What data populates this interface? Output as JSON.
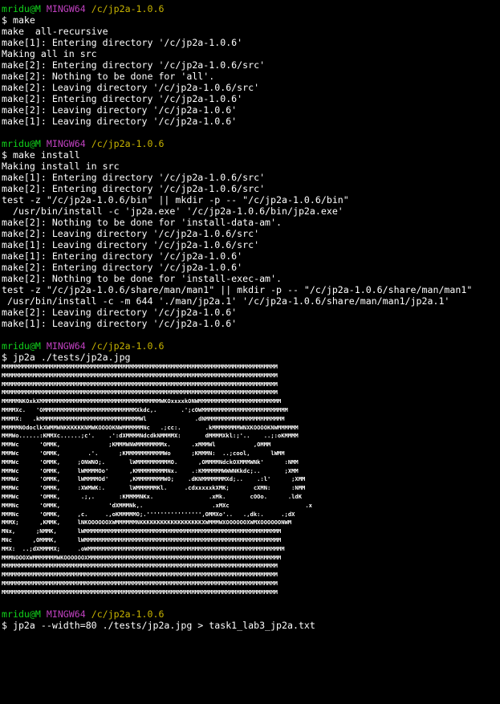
{
  "prompt": {
    "user": "mridu@M",
    "host": "MINGW64",
    "path": "/c/jp2a-1.0.6"
  },
  "blocks": [
    {
      "command": "$ make",
      "output": [
        "make  all-recursive",
        "make[1]: Entering directory '/c/jp2a-1.0.6'",
        "Making all in src",
        "make[2]: Entering directory '/c/jp2a-1.0.6/src'",
        "make[2]: Nothing to be done for 'all'.",
        "make[2]: Leaving directory '/c/jp2a-1.0.6/src'",
        "make[2]: Entering directory '/c/jp2a-1.0.6'",
        "make[2]: Leaving directory '/c/jp2a-1.0.6'",
        "make[1]: Leaving directory '/c/jp2a-1.0.6'"
      ]
    },
    {
      "command": "$ make install",
      "output": [
        "Making install in src",
        "make[1]: Entering directory '/c/jp2a-1.0.6/src'",
        "make[2]: Entering directory '/c/jp2a-1.0.6/src'",
        "test -z \"/c/jp2a-1.0.6/bin\" || mkdir -p -- \"/c/jp2a-1.0.6/bin\"",
        "  /usr/bin/install -c 'jp2a.exe' '/c/jp2a-1.0.6/bin/jp2a.exe'",
        "make[2]: Nothing to be done for 'install-data-am'.",
        "make[2]: Leaving directory '/c/jp2a-1.0.6/src'",
        "make[1]: Leaving directory '/c/jp2a-1.0.6/src'",
        "make[1]: Entering directory '/c/jp2a-1.0.6'",
        "make[2]: Entering directory '/c/jp2a-1.0.6'",
        "make[2]: Nothing to be done for 'install-exec-am'.",
        "test -z \"/c/jp2a-1.0.6/share/man/man1\" || mkdir -p -- \"/c/jp2a-1.0.6/share/man/man1\"",
        " /usr/bin/install -c -m 644 './man/jp2a.1' '/c/jp2a-1.0.6/share/man/man1/jp2a.1'",
        "make[2]: Leaving directory '/c/jp2a-1.0.6'",
        "make[1]: Leaving directory '/c/jp2a-1.0.6'"
      ]
    },
    {
      "command": "$ jp2a ./tests/jp2a.jpg",
      "output": []
    }
  ],
  "ascii_art": [
    "MMMMMMMMMMMMMMMMMMMMMMMMMMMMMMMMMMMMMMMMMMMMMMMMMMMMMMMMMMMMMMMMMMMMMMMMMMMMMMMM",
    "MMMMMMMMMMMMMMMMMMMMMMMMMMMMMMMMMMMMMMMMMMMMMMMMMMMMMMMMMMMMMMMMMMMMMMMMMMMMMMMM",
    "MMMMMMMMMMMMMMMMMMMMMMMMMMMMMMMMMMMMMMMMMMMMMMMMMMMMMMMMMMMMMMMMMMMMMMMMMMMMMMMM",
    "MMMMMMMMMMMMMMMMMMMMMMMMMMMMMMMMMMMMMMMMMMMMMMMMMMMMMMMMMMMMMMMMMMMMMMMMMMMMMMMM",
    "MMMMMNKOxkXMMMMMMMMMMMMMMMMMMMMMMMMMMMMMMMMMMMWKOxxxxkONWMMMMMMMMMMMMMMMMMMMMMMMM",
    "MMMMXc.   'OMMMMMMMMMMMMMMMMMMMMMMMMMMMXkdc,.       .';cOWMMMMMMMMMMMMMMMMMMMMMMMMM",
    "MMMMX:   .kMMMMMMMMMMMMMMMMMMMMMMMMMMMMMWl              .dNMMMMMMMMMMMMMMMMMMMMMMM",
    "MMMMMNOdoclkXWMMWNKKKKKKNMWKOOOOKNWMMMMMMNc   .;cc:.       .kMMMMMMMMWNXKOOOOKNWMMMMMM",
    "MMMWo......:KMMXc......;c'.    .':dXMMMMNdcdkNMMMMX:       dMMMMXkl:;'..    ..;:oKMMMM",
    "MMMWc      'OMMK,              ;KMMMWNWMMMMMMMMx.      .xMMMWl           ,OMMM",
    "MMMWc      'OMMK,        .'.      ;KMMMMMMMMMMMWo      ;KMMMN:  ..;cool,      lWMM",
    "MMMWc      'OMMK,     ;ONWNO;.       lWMMMMMMMMMMO.      ,OMMMMNdckOXMMMWNk'      :NMM",
    "MMMWc      'OMMK,     lWMMMMOo'      ,KMMMMMMMMMNx.    .:KMMMMMMWWWNKkdc;..       ;XMM",
    "MMMWc      'OMMK,     lWMMMMOd'      ,KMMMMMMMMWO;    .dKNMMMMMMMXd;..    .:l'      ;XMM",
    "MMMWc      'OMMK,     :XWMWK:.       lWMMMMMMKl.     .cdxxxxxkXMK;       cXMN:      :NMM",
    "MMMWc      'OMMK,      .;,.       :KMMMMNKx.                .xMk.       cOOo.      .ldK",
    "MMMNc      'OMMK,              'dXMMMNk,.                    .xMXc                      .x",
    "MMMNc      'OMMK,     ,c.     .,oKMMMMMO;.'''''''''''''''',OMMXo'..   .,dk:.     .;dX",
    "MMMX;      ,KMMK,     lNKOOOOOOXWMMMMMMNKKKKKKKKKKKKKKKKKKXWMMMWXOOOOOOXWMXOOOOOONWM",
    "MNx,      ;NMMK,      lWMMMMMMMMMMMMMMMMMMMMMMMMMMMMMMMMMMMMMMMMMMMMMMMMMMMMMMMMM",
    "MNc      ,OMMMK,      lWMMMMMMMMMMMMMMMMMMMMMMMMMMMMMMMMMMMMMMMMMMMMMMMMMMMMMMMMM",
    "MMX:  ..;dXMMMMX;     .oWMMMMMMMMMMMMMMMMMMMMMMMMMMMMMMMMMMMMMMMMMMMMMMMMMMMMMMMMM",
    "MMMNOOOXWMMMMMMMWKOOOOOOXMMMMMMMMMMMMMMMMMMMMMMMMMMMMMMMMMMMMMMMMMMMMMMMMMMMMMMMM",
    "MMMMMMMMMMMMMMMMMMMMMMMMMMMMMMMMMMMMMMMMMMMMMMMMMMMMMMMMMMMMMMMMMMMMMMMMMMMMMMMM",
    "MMMMMMMMMMMMMMMMMMMMMMMMMMMMMMMMMMMMMMMMMMMMMMMMMMMMMMMMMMMMMMMMMMMMMMMMMMMMMMMM",
    "MMMMMMMMMMMMMMMMMMMMMMMMMMMMMMMMMMMMMMMMMMMMMMMMMMMMMMMMMMMMMMMMMMMMMMMMMMMMMMMM",
    "MMMMMMMMMMMMMMMMMMMMMMMMMMMMMMMMMMMMMMMMMMMMMMMMMMMMMMMMMMMMMMMMMMMMMMMMMMMMMMMM"
  ],
  "final_command": "$ jp2a --width=80 ./tests/jp2a.jpg > task1_lab3_jp2a.txt",
  "colors": {
    "background": "#000000",
    "text": "#ffffff",
    "user": "#11d31b",
    "host": "#c041c0",
    "path": "#c7b300"
  }
}
